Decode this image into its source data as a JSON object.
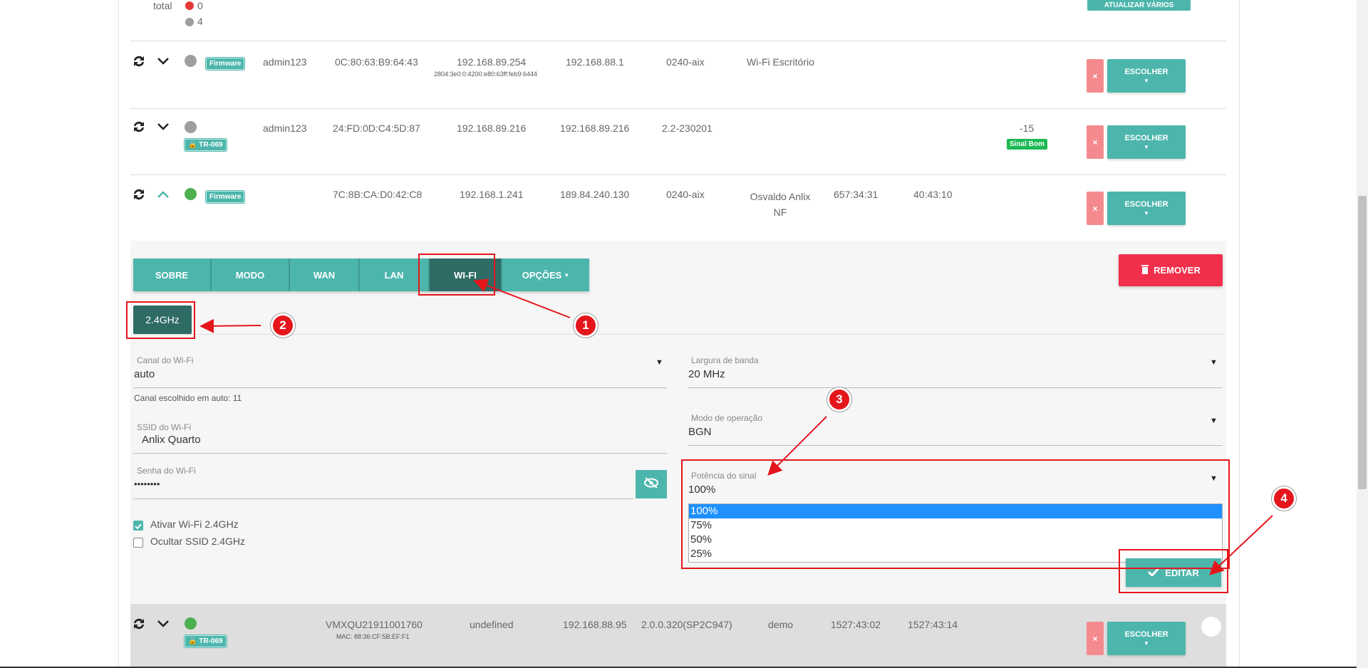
{
  "top": {
    "total_label": "total",
    "online_count": "0",
    "offline_count": "4",
    "update_button": "ATUALIZAR VÁRIOS"
  },
  "devices": [
    {
      "status": "offline",
      "badge": "Firmware",
      "user": "admin123",
      "mac": "0C:80:63:B9:64:43",
      "ip": "192.168.89.254",
      "ipv6": "2804:3e0:0:4200:e80:63ff:feb9:6444",
      "wan_ip": "192.168.88.1",
      "version": "0240-aix",
      "ssid": "Wi-Fi Escritório",
      "uptime": "",
      "wan_uptime": "",
      "signal": "",
      "signal_badge": ""
    },
    {
      "status": "offline",
      "badge": "TR-069",
      "user": "admin123",
      "mac": "24:FD:0D:C4:5D:87",
      "ip": "192.168.89.216",
      "ipv6": "",
      "wan_ip": "192.168.89.216",
      "version": "2.2-230201",
      "ssid": "",
      "uptime": "",
      "wan_uptime": "",
      "signal": "-15",
      "signal_badge": "Sinal Bom"
    },
    {
      "status": "online",
      "badge": "Firmware",
      "user": "",
      "mac": "7C:8B:CA:D0:42:C8",
      "ip": "192.168.1.241",
      "ipv6": "",
      "wan_ip": "189.84.240.130",
      "version": "0240-aix",
      "ssid": "Osvaldo Anlix NF",
      "uptime": "657:34:31",
      "wan_uptime": "40:43:10",
      "signal": "",
      "signal_badge": ""
    }
  ],
  "row_buttons": {
    "choose": "ESCOLHER",
    "remove_x": "×"
  },
  "tabs": [
    "SOBRE",
    "MODO",
    "WAN",
    "LAN",
    "WI-FI",
    "OPÇÕES"
  ],
  "remove_label": "REMOVER",
  "band": "2.4GHz",
  "wifi": {
    "channel_label": "Canal do Wi-Fi",
    "channel_value": "auto",
    "channel_hint": "Canal escolhido em auto: 11",
    "ssid_label": "SSID do Wi-Fi",
    "ssid_value": "Anlix Quarto",
    "password_label": "Senha do Wi-Fi",
    "password_value": "••••••••",
    "enable_label": "Ativar Wi-Fi 2.4GHz",
    "hide_label": "Ocultar SSID 2.4GHz",
    "bandwidth_label": "Largura de banda",
    "bandwidth_value": "20 MHz",
    "mode_label": "Modo de operação",
    "mode_value": "BGN",
    "power_label": "Potência do sinal",
    "power_value": "100%",
    "power_options": [
      "100%",
      "75%",
      "50%",
      "25%"
    ]
  },
  "edit_label": "EDITAR",
  "last_device": {
    "badge": "TR-069",
    "serial": "VMXQU21911001760",
    "mac": "MAC: 88:36:CF:5B:EF:F1",
    "user": "undefined",
    "ip": "192.168.88.95",
    "version": "2.0.0.320(SP2C947)",
    "ssid": "demo",
    "uptime": "1527:43:02",
    "wan_uptime": "1527:43:14"
  },
  "annotations": [
    "1",
    "2",
    "3",
    "4"
  ],
  "colors": {
    "teal": "#4db6ac",
    "dark_teal": "#2e6b65",
    "red": "#f0304a",
    "annotation": "#e4161b",
    "online": "#4caf50",
    "offline": "#9e9e9e"
  }
}
